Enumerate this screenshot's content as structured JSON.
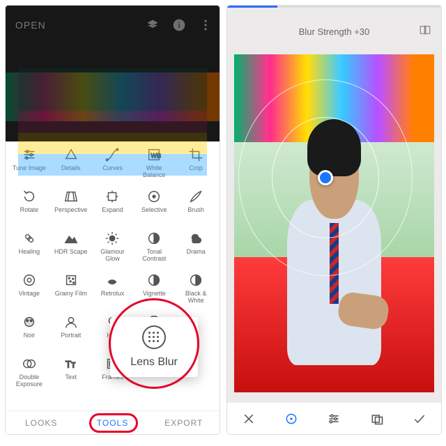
{
  "left": {
    "header": {
      "open_label": "OPEN",
      "icons": [
        "layers-icon",
        "info-icon",
        "more-icon"
      ]
    },
    "tools": [
      {
        "icon": "tune",
        "label": "Tune Image"
      },
      {
        "icon": "details",
        "label": "Details"
      },
      {
        "icon": "curves",
        "label": "Curves"
      },
      {
        "icon": "wb",
        "label": "White\nBalance"
      },
      {
        "icon": "crop",
        "label": "Crop"
      },
      {
        "icon": "rotate",
        "label": "Rotate"
      },
      {
        "icon": "perspective",
        "label": "Perspective"
      },
      {
        "icon": "expand",
        "label": "Expand"
      },
      {
        "icon": "selective",
        "label": "Selective"
      },
      {
        "icon": "brush",
        "label": "Brush"
      },
      {
        "icon": "healing",
        "label": "Healing"
      },
      {
        "icon": "hdr",
        "label": "HDR Scape"
      },
      {
        "icon": "glamour",
        "label": "Glamour\nGlow"
      },
      {
        "icon": "tonal",
        "label": "Tonal\nContrast"
      },
      {
        "icon": "drama",
        "label": "Drama"
      },
      {
        "icon": "vintage",
        "label": "Vintage"
      },
      {
        "icon": "grainy",
        "label": "Grainy Film"
      },
      {
        "icon": "retrolux",
        "label": "Retrolux"
      },
      {
        "icon": "vignette",
        "label": "Vignette"
      },
      {
        "icon": "bw",
        "label": "Black &\nWhite"
      },
      {
        "icon": "noir",
        "label": "Noir"
      },
      {
        "icon": "portrait",
        "label": "Portrait"
      },
      {
        "icon": "headpose",
        "label": "Hea"
      },
      {
        "icon": "lensblur",
        "label": ""
      },
      {
        "icon": "blank",
        "label": ""
      },
      {
        "icon": "double",
        "label": "Double\nExposure"
      },
      {
        "icon": "text",
        "label": "Text"
      },
      {
        "icon": "frames",
        "label": "Frames"
      },
      {
        "icon": "blank",
        "label": ""
      },
      {
        "icon": "blank",
        "label": ""
      }
    ],
    "tooltip_label": "Lens Blur",
    "tabs": {
      "looks": "LOOKS",
      "tools": "TOOLS",
      "export": "EXPORT",
      "active": "tools"
    }
  },
  "right": {
    "title": "Blur Strength +30",
    "blur_strength": 30,
    "bottom_icons": [
      "cancel",
      "effect",
      "adjust",
      "styles",
      "apply"
    ]
  }
}
